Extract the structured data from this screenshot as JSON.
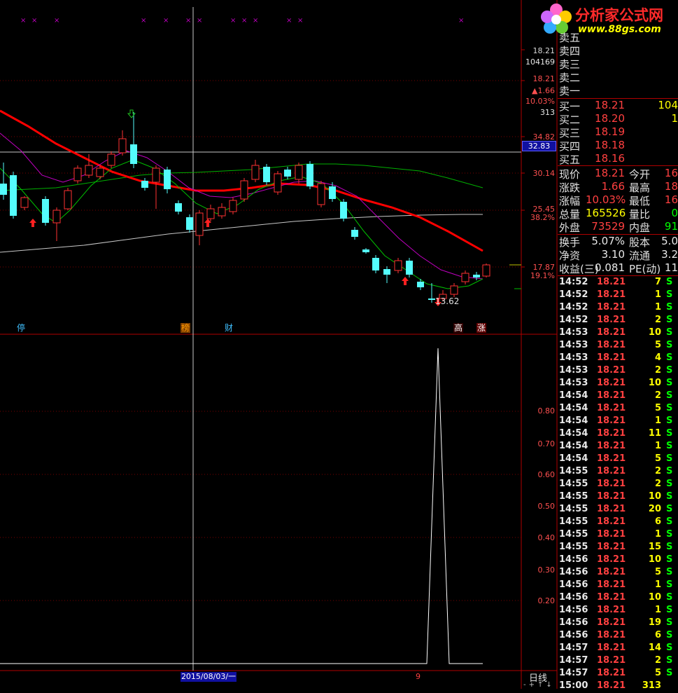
{
  "logo": {
    "brand": "分析家公式网",
    "url_text": "www.88gs.com"
  },
  "price_axis": {
    "ticks": [
      "18.21",
      "104169",
      "18.21",
      "▲1.66",
      "10.03%",
      "313",
      "34.82",
      "32.83",
      "30.14",
      "25.45",
      "38.2%",
      "17.87",
      "19.1%"
    ]
  },
  "indicator_axis": {
    "ticks": [
      "0.80",
      "0.70",
      "0.60",
      "0.50",
      "0.40",
      "0.30",
      "0.20"
    ]
  },
  "crosshair": {
    "price": "32.83",
    "date": "2015/08/03/一"
  },
  "bottom_bar": {
    "label_9": "9",
    "period": "日线"
  },
  "markers": [
    {
      "text": "停",
      "color": "#40c0ff"
    },
    {
      "text": "榜",
      "color": "#ff9900"
    },
    {
      "text": "财",
      "color": "#40c0ff"
    },
    {
      "text": "高",
      "color": "#ffffff"
    },
    {
      "text": "涨",
      "color": "#ffffff"
    }
  ],
  "low_label": "13.62",
  "order_book": {
    "asks": [
      {
        "label": "卖五",
        "price": "",
        "vol": ""
      },
      {
        "label": "卖四",
        "price": "",
        "vol": ""
      },
      {
        "label": "卖三",
        "price": "",
        "vol": ""
      },
      {
        "label": "卖二",
        "price": "",
        "vol": ""
      },
      {
        "label": "卖一",
        "price": "",
        "vol": ""
      }
    ],
    "bids": [
      {
        "label": "买一",
        "price": "18.21",
        "vol": "104"
      },
      {
        "label": "买二",
        "price": "18.20",
        "vol": "1"
      },
      {
        "label": "买三",
        "price": "18.19",
        "vol": ""
      },
      {
        "label": "买四",
        "price": "18.18",
        "vol": ""
      },
      {
        "label": "买五",
        "price": "18.16",
        "vol": ""
      }
    ]
  },
  "quote": [
    {
      "l1": "现价",
      "v1": "18.21",
      "l2": "今开",
      "v2": "16"
    },
    {
      "l1": "涨跌",
      "v1": "1.66",
      "l2": "最高",
      "v2": "18"
    },
    {
      "l1": "涨幅",
      "v1": "10.03%",
      "l2": "最低",
      "v2": "16"
    },
    {
      "l1": "总量",
      "v1": "165526",
      "l2": "量比",
      "v2": "0"
    },
    {
      "l1": "外盘",
      "v1": "73529",
      "l2": "内盘",
      "v2": "91"
    }
  ],
  "fundamentals": [
    {
      "l1": "换手",
      "v1": "5.07%",
      "l2": "股本",
      "v2": "5.0"
    },
    {
      "l1": "净资",
      "v1": "3.10",
      "l2": "流通",
      "v2": "3.2"
    },
    {
      "l1": "收益(三)",
      "v1": "0.081",
      "l2": "PE(动)",
      "v2": "11"
    }
  ],
  "ticks": [
    {
      "time": "14:52",
      "price": "18.21",
      "vol": "7",
      "side": "S"
    },
    {
      "time": "14:52",
      "price": "18.21",
      "vol": "1",
      "side": "S"
    },
    {
      "time": "14:52",
      "price": "18.21",
      "vol": "1",
      "side": "S"
    },
    {
      "time": "14:52",
      "price": "18.21",
      "vol": "2",
      "side": "S"
    },
    {
      "time": "14:53",
      "price": "18.21",
      "vol": "10",
      "side": "S"
    },
    {
      "time": "14:53",
      "price": "18.21",
      "vol": "5",
      "side": "S"
    },
    {
      "time": "14:53",
      "price": "18.21",
      "vol": "4",
      "side": "S"
    },
    {
      "time": "14:53",
      "price": "18.21",
      "vol": "2",
      "side": "S"
    },
    {
      "time": "14:53",
      "price": "18.21",
      "vol": "10",
      "side": "S"
    },
    {
      "time": "14:54",
      "price": "18.21",
      "vol": "2",
      "side": "S"
    },
    {
      "time": "14:54",
      "price": "18.21",
      "vol": "5",
      "side": "S"
    },
    {
      "time": "14:54",
      "price": "18.21",
      "vol": "1",
      "side": "S"
    },
    {
      "time": "14:54",
      "price": "18.21",
      "vol": "11",
      "side": "S"
    },
    {
      "time": "14:54",
      "price": "18.21",
      "vol": "1",
      "side": "S"
    },
    {
      "time": "14:54",
      "price": "18.21",
      "vol": "5",
      "side": "S"
    },
    {
      "time": "14:55",
      "price": "18.21",
      "vol": "2",
      "side": "S"
    },
    {
      "time": "14:55",
      "price": "18.21",
      "vol": "2",
      "side": "S"
    },
    {
      "time": "14:55",
      "price": "18.21",
      "vol": "10",
      "side": "S"
    },
    {
      "time": "14:55",
      "price": "18.21",
      "vol": "20",
      "side": "S"
    },
    {
      "time": "14:55",
      "price": "18.21",
      "vol": "6",
      "side": "S"
    },
    {
      "time": "14:55",
      "price": "18.21",
      "vol": "1",
      "side": "S"
    },
    {
      "time": "14:55",
      "price": "18.21",
      "vol": "15",
      "side": "S"
    },
    {
      "time": "14:56",
      "price": "18.21",
      "vol": "10",
      "side": "S"
    },
    {
      "time": "14:56",
      "price": "18.21",
      "vol": "5",
      "side": "S"
    },
    {
      "time": "14:56",
      "price": "18.21",
      "vol": "1",
      "side": "S"
    },
    {
      "time": "14:56",
      "price": "18.21",
      "vol": "10",
      "side": "S"
    },
    {
      "time": "14:56",
      "price": "18.21",
      "vol": "1",
      "side": "S"
    },
    {
      "time": "14:56",
      "price": "18.21",
      "vol": "19",
      "side": "S"
    },
    {
      "time": "14:56",
      "price": "18.21",
      "vol": "6",
      "side": "S"
    },
    {
      "time": "14:57",
      "price": "18.21",
      "vol": "14",
      "side": "S"
    },
    {
      "time": "14:57",
      "price": "18.21",
      "vol": "2",
      "side": "S"
    },
    {
      "time": "14:57",
      "price": "18.21",
      "vol": "5",
      "side": "S"
    },
    {
      "time": "15:00",
      "price": "18.21",
      "vol": "313",
      "side": ""
    }
  ],
  "colors": {
    "up": "#ff3232",
    "down": "#54fcfc",
    "ma_slow": "#ff0000",
    "ma_green": "#00c000",
    "ma_magenta": "#c000c0",
    "ma_white": "#c8c8c8",
    "grid": "#8b0000"
  }
}
